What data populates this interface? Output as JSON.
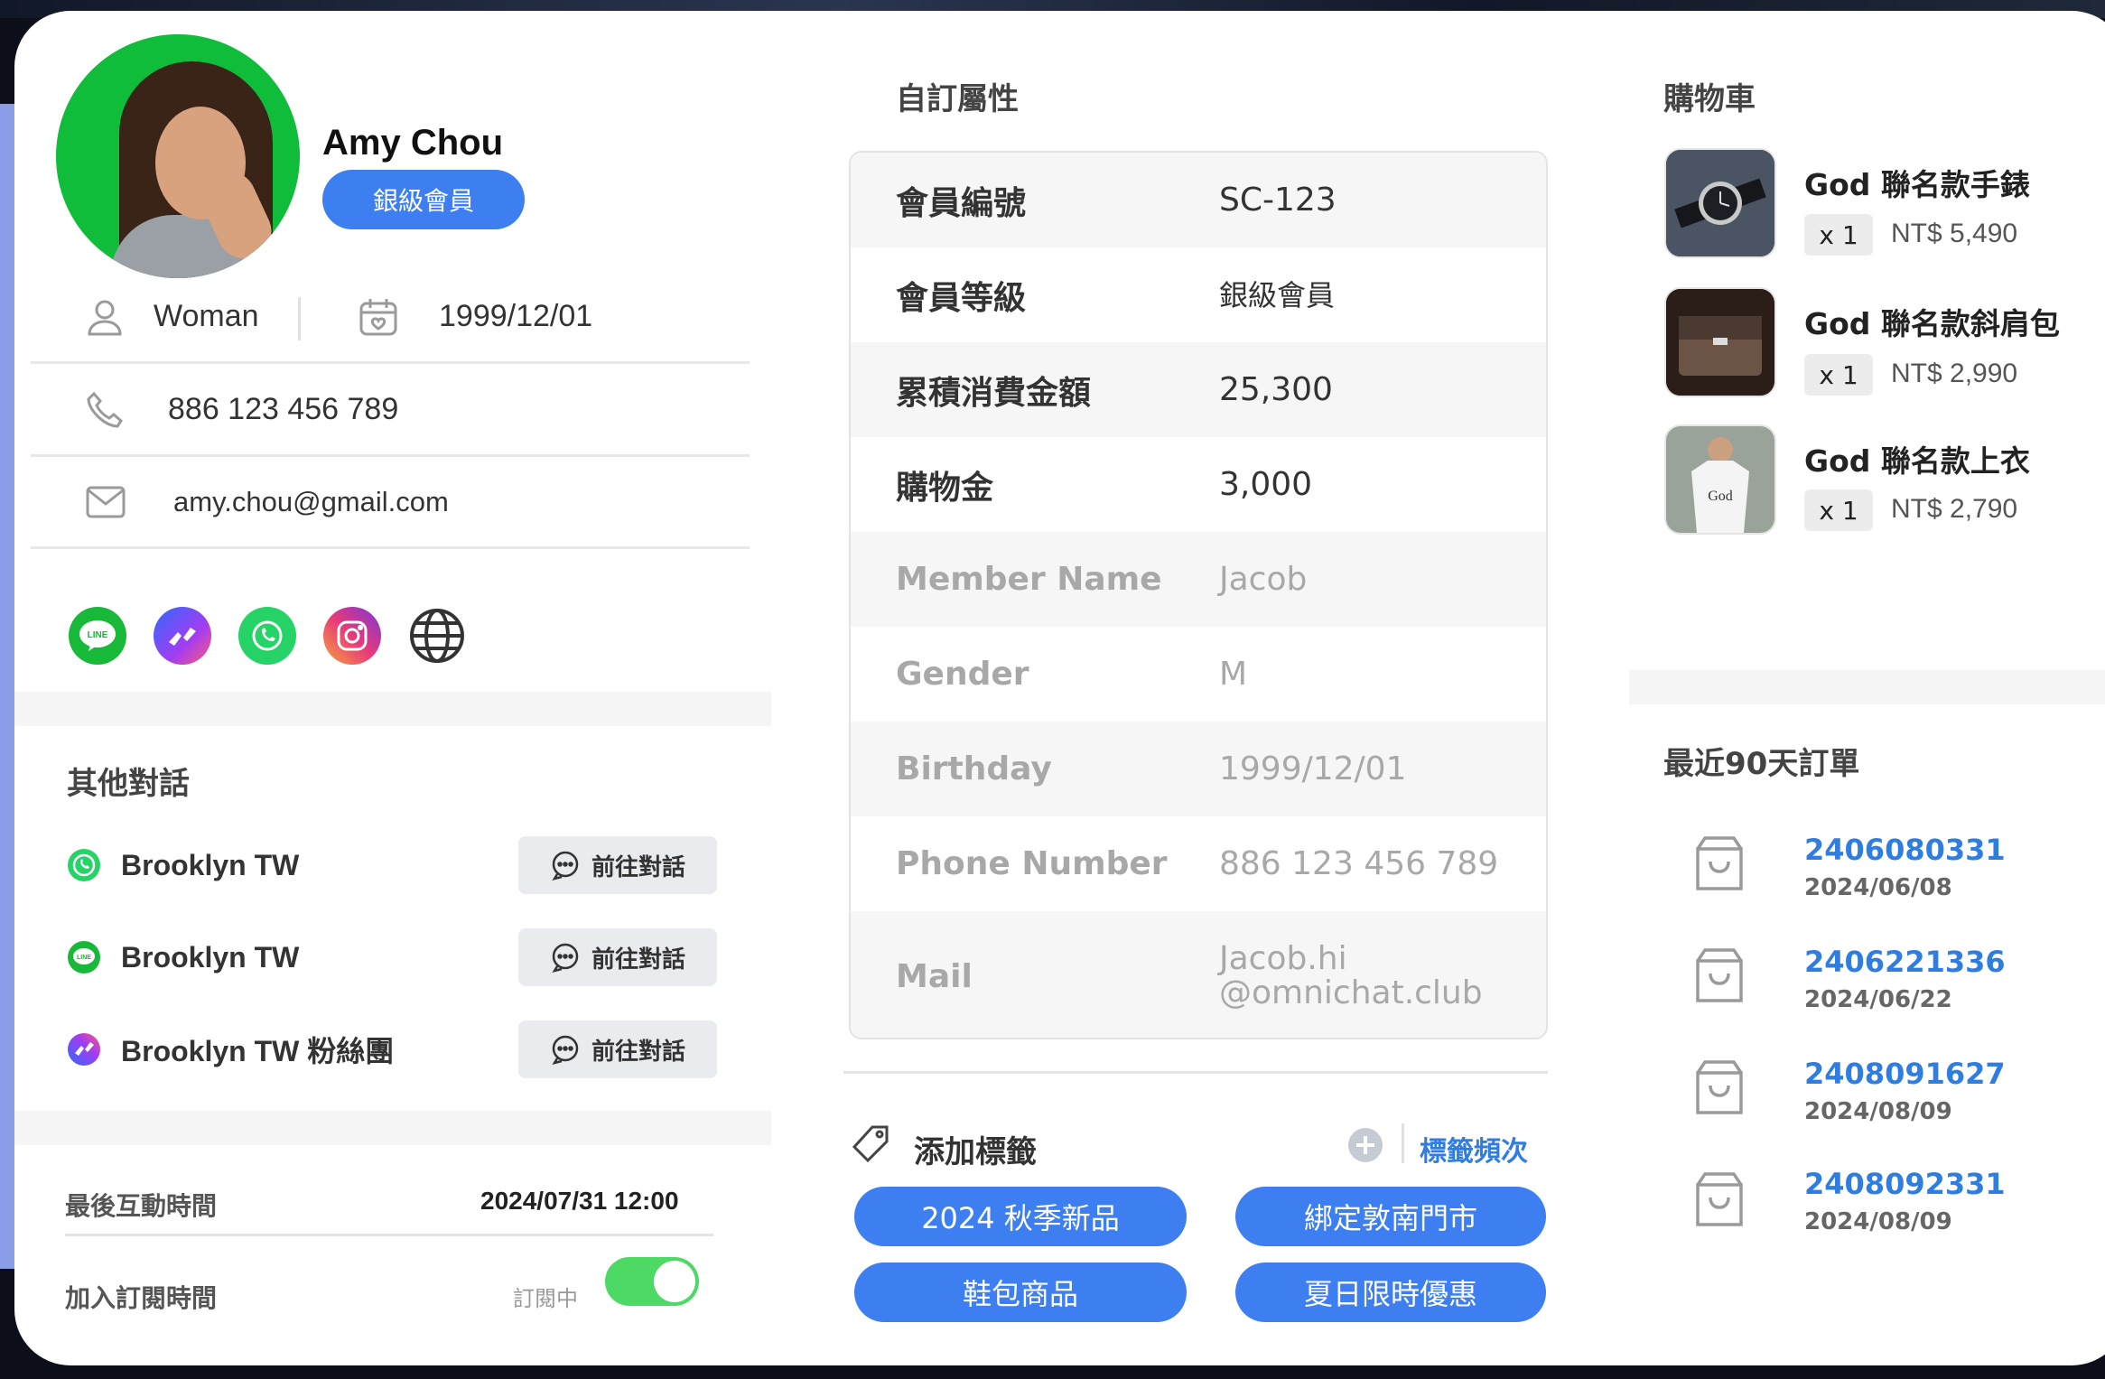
{
  "profile": {
    "name": "Amy Chou",
    "member_level": "銀級會員",
    "gender": "Woman",
    "birthday": "1999/12/01",
    "phone": "886 123 456 789",
    "email": "amy.chou@gmail.com"
  },
  "social_channels": [
    "line-icon",
    "messenger-icon",
    "whatsapp-icon",
    "instagram-icon",
    "web-icon"
  ],
  "other_conversations": {
    "title": "其他對話",
    "button_label": "前往對話",
    "items": [
      {
        "channel": "whatsapp-icon",
        "name": "Brooklyn TW"
      },
      {
        "channel": "line-icon",
        "name": "Brooklyn TW"
      },
      {
        "channel": "messenger-icon",
        "name": "Brooklyn TW 粉絲團"
      }
    ]
  },
  "interaction": {
    "last_interaction_label": "最後互動時間",
    "last_interaction_value": "2024/07/31 12:00",
    "subscribe_label": "加入訂閱時間",
    "subscribe_status": "訂閱中",
    "subscribed": true
  },
  "custom_attributes": {
    "title": "自訂屬性",
    "rows": [
      {
        "key": "會員編號",
        "value": "SC-123",
        "dim": false
      },
      {
        "key": "會員等級",
        "value": "銀級會員",
        "dim": false
      },
      {
        "key": "累積消費金額",
        "value": "25,300",
        "dim": false
      },
      {
        "key": "購物金",
        "value": "3,000",
        "dim": false
      },
      {
        "key": "Member Name",
        "value": "Jacob",
        "dim": true
      },
      {
        "key": "Gender",
        "value": "M",
        "dim": true
      },
      {
        "key": "Birthday",
        "value": "1999/12/01",
        "dim": true
      },
      {
        "key": "Phone Number",
        "value": "886 123 456 789",
        "dim": true
      },
      {
        "key": "Mail",
        "value": "Jacob.hi\n@omnichat.club",
        "dim": true
      }
    ]
  },
  "tags": {
    "title": "添加標籤",
    "frequency_link": "標籤頻次",
    "items": [
      "2024 秋季新品",
      "綁定敦南門市",
      "鞋包商品",
      "夏日限時優惠"
    ]
  },
  "cart": {
    "title": "購物車",
    "items": [
      {
        "name": "God 聯名款手錶",
        "qty": "x 1",
        "price": "NT$ 5,490"
      },
      {
        "name": "God 聯名款斜肩包",
        "qty": "x 1",
        "price": "NT$ 2,990"
      },
      {
        "name": "God 聯名款上衣",
        "qty": "x 1",
        "price": "NT$ 2,790"
      }
    ]
  },
  "orders": {
    "title": "最近90天訂單",
    "items": [
      {
        "id": "2406080331",
        "date": "2024/06/08"
      },
      {
        "id": "2406221336",
        "date": "2024/06/22"
      },
      {
        "id": "2408091627",
        "date": "2024/08/09"
      },
      {
        "id": "2408092331",
        "date": "2024/08/09"
      }
    ]
  },
  "colors": {
    "accent": "#3d7ff0",
    "toggle_on": "#4cd964",
    "order_link": "#2f7de1"
  }
}
